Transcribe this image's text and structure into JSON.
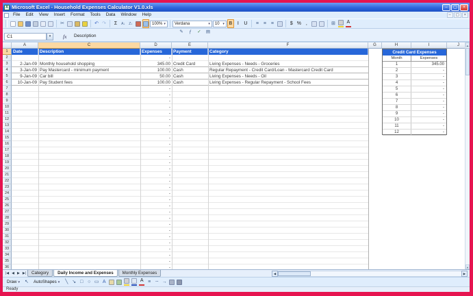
{
  "colors": {
    "frame_border": "#e61450",
    "titlebar_blue": "#2e66dd",
    "header_blue": "#2767d9",
    "selection_tan": "#fbd8a2",
    "toolbar_bg": "#dfedfc"
  },
  "window": {
    "title": "Microsoft Excel - Household Expenses Calculator V1.0.xls",
    "controls": {
      "minimize": "–",
      "restore": "▢",
      "close": "×"
    }
  },
  "menu_bar": {
    "items": [
      "File",
      "Edit",
      "View",
      "Insert",
      "Format",
      "Tools",
      "Data",
      "Window",
      "Help"
    ],
    "window_controls": [
      "–",
      "▢",
      "×"
    ]
  },
  "floating_toolbar": {
    "icons": [
      {
        "name": "pencil-icon",
        "glyph": "✎",
        "color": "#44618c"
      },
      {
        "name": "function-icon",
        "glyph": "ƒ",
        "color": "#44618c"
      },
      {
        "name": "check-icon",
        "glyph": "✓",
        "color": "#3a7a3a"
      },
      {
        "name": "grid-icon",
        "glyph": "▤",
        "color": "#44618c"
      }
    ]
  },
  "standard_toolbar": {
    "zoom_value": "100%",
    "icons": [
      {
        "name": "new-workbook-icon",
        "box": "#fdfdfd"
      },
      {
        "name": "open-icon",
        "box": "#f2c96e"
      },
      {
        "name": "save-icon",
        "box": "#6f8fc9"
      },
      {
        "name": "print-icon",
        "box": "#c3cfdf"
      },
      {
        "name": "print-preview-icon",
        "box": "#e7eef8"
      },
      {
        "name": "spelling-icon",
        "box": "#dde7f5"
      },
      {
        "sep": true
      },
      {
        "name": "cut-icon",
        "glyph": "✂",
        "color": "#44618c"
      },
      {
        "name": "copy-icon",
        "box": "#d7e2f2"
      },
      {
        "name": "paste-icon",
        "box": "#d9b964"
      },
      {
        "name": "format-painter-icon",
        "box": "#ead23e"
      },
      {
        "sep": true
      },
      {
        "name": "undo-icon",
        "glyph": "↶",
        "color": "#3b66c4"
      },
      {
        "name": "redo-icon",
        "glyph": "↷",
        "color": "#9db6dd"
      },
      {
        "sep": true
      },
      {
        "name": "autosum-icon",
        "glyph": "Σ",
        "color": "#222222"
      },
      {
        "name": "sort-ascending-icon",
        "glyph": "A↓",
        "color": "#44618c",
        "small": true
      },
      {
        "name": "sort-descending-icon",
        "glyph": "Z↓",
        "color": "#44618c",
        "small": true
      },
      {
        "name": "chart-wizard-icon",
        "box": "#cf6a54"
      },
      {
        "name": "drawing-toolbar-toggle-icon",
        "box": "#9cc2ea",
        "pressed": true
      }
    ]
  },
  "formatting_toolbar": {
    "font_name": "Verdana",
    "font_size": "10",
    "icons": [
      {
        "name": "bold-button",
        "glyph": "B",
        "color": "#111111",
        "pressed": true
      },
      {
        "name": "italic-button",
        "glyph": "I",
        "color": "#111111"
      },
      {
        "name": "underline-button",
        "glyph": "U",
        "color": "#111111"
      },
      {
        "sep": true
      },
      {
        "name": "align-left-icon",
        "glyph": "≡",
        "color": "#44618c"
      },
      {
        "name": "align-center-icon",
        "glyph": "≡",
        "color": "#44618c"
      },
      {
        "name": "align-right-icon",
        "glyph": "≡",
        "color": "#44618c"
      },
      {
        "name": "merge-center-icon",
        "box": "#cfdcee"
      },
      {
        "sep": true
      },
      {
        "name": "currency-style-icon",
        "glyph": "$",
        "color": "#222222"
      },
      {
        "name": "percent-style-icon",
        "glyph": "%",
        "color": "#222222"
      },
      {
        "name": "comma-style-icon",
        "glyph": ",",
        "color": "#222222"
      },
      {
        "name": "increase-decimal-icon",
        "box": "#d7e2f2"
      },
      {
        "name": "decrease-decimal-icon",
        "box": "#d7e2f2"
      },
      {
        "sep": true
      },
      {
        "name": "borders-icon",
        "glyph": "⊞",
        "color": "#44618c"
      },
      {
        "name": "fill-color-icon",
        "box": "#d0d0d0",
        "bar": "#f2d12e"
      },
      {
        "name": "font-color-icon",
        "glyph": "A",
        "color": "#222222",
        "bar": "#d23535"
      }
    ]
  },
  "formula_bar": {
    "name_box": "C1",
    "dropdown_glyph": "▾",
    "fx_label": "fx",
    "content": "Description"
  },
  "grid": {
    "column_letters": [
      "A",
      "C",
      "D",
      "E",
      "F",
      "G",
      "H",
      "I",
      "J"
    ],
    "selected_column": "C",
    "selected_row": 1,
    "row_count": 36,
    "empty_expense_placeholder": "-",
    "table": {
      "headers": [
        "Date",
        "Description",
        "Expenses",
        "Payment",
        "Category"
      ],
      "rows": [
        {
          "row": 3,
          "date": "2-Jan-09",
          "description": "Monthly household shopping",
          "expenses": "345.00",
          "payment": "Credit Card",
          "category": "Living Expenses - Needs - Groceries"
        },
        {
          "row": 4,
          "date": "3-Jan-09",
          "description": "Pay Mastercard - minimum payment",
          "expenses": "100.00",
          "payment": "Cash",
          "category": "Regular Repayment - Credit Card/Loan - Mastercard Credit Card"
        },
        {
          "row": 5,
          "date": "9-Jan-09",
          "description": "Car bill",
          "expenses": "50.00",
          "payment": "Cash",
          "category": "Living Expenses - Needs - Oil"
        },
        {
          "row": 6,
          "date": "10-Jan-09",
          "description": "Pay Student fees",
          "expenses": "100.00",
          "payment": "Cash",
          "category": "Living Expenses - Regular Repayment - School Fees"
        }
      ]
    },
    "credit_card_panel": {
      "title": "Credit Card Expenses",
      "month_label": "Month",
      "expenses_label": "Expenses",
      "rows": [
        {
          "month": 1,
          "expenses": "345.00"
        },
        {
          "month": 2,
          "expenses": "-"
        },
        {
          "month": 3,
          "expenses": "-"
        },
        {
          "month": 4,
          "expenses": "-"
        },
        {
          "month": 5,
          "expenses": "-"
        },
        {
          "month": 6,
          "expenses": "-"
        },
        {
          "month": 7,
          "expenses": "-"
        },
        {
          "month": 8,
          "expenses": "-"
        },
        {
          "month": 9,
          "expenses": "-"
        },
        {
          "month": 10,
          "expenses": "-"
        },
        {
          "month": 11,
          "expenses": "-"
        },
        {
          "month": 12,
          "expenses": "-"
        }
      ]
    }
  },
  "sheet_tabs": {
    "nav_buttons": [
      "|◀",
      "◀",
      "▶",
      "▶|"
    ],
    "tabs": [
      "Category",
      "Daily Income and Expenses",
      "Monthly Expenses"
    ],
    "active_tab": "Daily Income and Expenses"
  },
  "drawing_toolbar": {
    "draw_label": "Draw",
    "autoshapes_label": "AutoShapes",
    "caret_glyph": "▾",
    "icons_left": [
      {
        "name": "select-arrow-icon",
        "glyph": "↖",
        "color": "#44618c"
      }
    ],
    "icons": [
      {
        "name": "line-icon",
        "glyph": "╲",
        "color": "#44618c"
      },
      {
        "name": "arrow-icon",
        "glyph": "↘",
        "color": "#44618c"
      },
      {
        "name": "rectangle-icon",
        "glyph": "□",
        "color": "#44618c"
      },
      {
        "name": "oval-icon",
        "glyph": "○",
        "color": "#44618c"
      },
      {
        "name": "text-box-icon",
        "glyph": "▭",
        "color": "#44618c"
      },
      {
        "name": "word-art-icon",
        "glyph": "A",
        "color": "#3d63b0"
      },
      {
        "name": "clip-art-icon",
        "box": "#e6d9a8"
      },
      {
        "name": "insert-picture-icon",
        "box": "#a9c99a"
      },
      {
        "name": "fill-color-icon",
        "box": "#d0d0d0",
        "bar": "#f2d12e"
      },
      {
        "name": "line-color-icon",
        "box": "#dfe8f4",
        "bar": "#2a4fb8"
      },
      {
        "name": "font-color-icon",
        "glyph": "A",
        "color": "#222222",
        "bar": "#d23535"
      },
      {
        "name": "line-style-icon",
        "glyph": "≡",
        "color": "#44618c"
      },
      {
        "name": "dash-style-icon",
        "glyph": "┄",
        "color": "#44618c"
      },
      {
        "name": "arrow-style-icon",
        "glyph": "→",
        "color": "#44618c"
      },
      {
        "name": "shadow-style-icon",
        "box": "#aab4c8"
      },
      {
        "name": "three-d-style-icon",
        "box": "#8d97ad"
      }
    ]
  },
  "status_bar": {
    "ready_label": "Ready"
  }
}
